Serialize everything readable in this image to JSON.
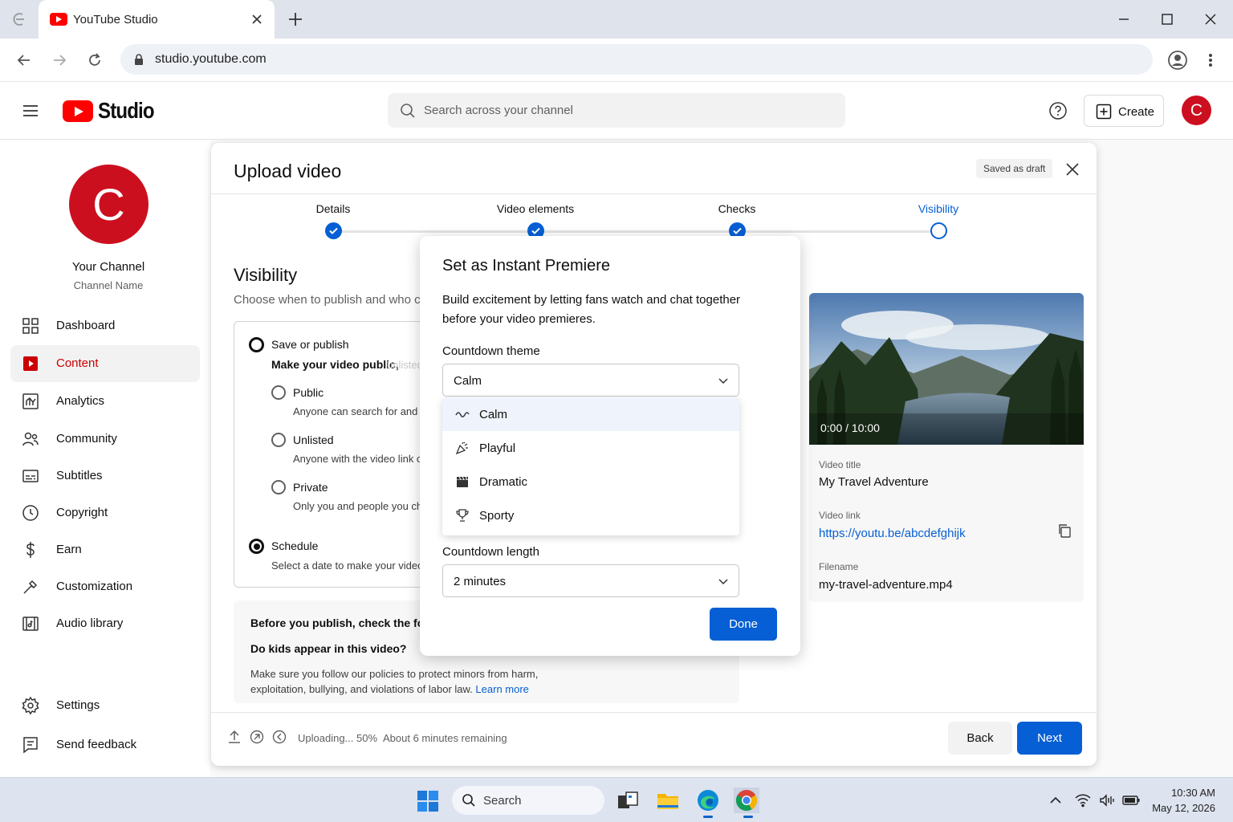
{
  "browser": {
    "tab_title": "YouTube Studio",
    "url": "studio.youtube.com"
  },
  "header": {
    "logo_text": "Studio",
    "search_placeholder": "Search across your channel",
    "create_label": "Create",
    "avatar_letter": "C"
  },
  "sidebar": {
    "avatar_letter": "C",
    "channel_title": "Your Channel",
    "channel_handle": "Channel Name",
    "items": [
      {
        "label": "Dashboard",
        "icon": "dashboard-icon"
      },
      {
        "label": "Content",
        "icon": "content-icon",
        "active": true
      },
      {
        "label": "Analytics",
        "icon": "analytics-icon"
      },
      {
        "label": "Community",
        "icon": "community-icon"
      },
      {
        "label": "Subtitles",
        "icon": "subtitles-icon"
      },
      {
        "label": "Copyright",
        "icon": "copyright-icon"
      },
      {
        "label": "Earn",
        "icon": "earn-icon"
      },
      {
        "label": "Customization",
        "icon": "customization-icon"
      },
      {
        "label": "Audio library",
        "icon": "audio-library-icon"
      }
    ],
    "bottom_items": [
      {
        "label": "Settings",
        "icon": "gear-icon"
      },
      {
        "label": "Send feedback",
        "icon": "feedback-icon"
      }
    ]
  },
  "upload": {
    "title": "Upload video",
    "draft_badge": "Saved as draft",
    "steps": [
      {
        "label": "Details",
        "state": "done"
      },
      {
        "label": "Video elements",
        "state": "done"
      },
      {
        "label": "Checks",
        "state": "done"
      },
      {
        "label": "Visibility",
        "state": "current"
      }
    ],
    "visibility": {
      "title": "Visibility",
      "subtitle": "Choose when to publish and who can see your video",
      "save_publish": "Save or publish",
      "save_publish_sub": "Make your video public,",
      "save_publish_sub_faded": "unlisted, or private",
      "options": [
        {
          "label": "Public",
          "desc": "Anyone can search for and"
        },
        {
          "label": "Unlisted",
          "desc": "Anyone with the video link c"
        },
        {
          "label": "Private",
          "desc": "Only you and people you ch"
        }
      ],
      "schedule": "Schedule",
      "schedule_desc": "Select a date to make your video"
    },
    "kids": {
      "heading": "Before you publish, check the following:",
      "question": "Do kids appear in this video?",
      "body": "Make sure you follow our policies to protect minors from harm, exploitation, bullying, and violations of labor law.",
      "learn_more": "Learn more"
    },
    "preview": {
      "time": "0:00 / 10:00",
      "title_label": "Video title",
      "title_value": "My Travel Adventure",
      "link_label": "Video link",
      "link_value": "https://youtu.be/abcdefghijk",
      "filename_label": "Filename",
      "filename_value": "my-travel-adventure.mp4"
    },
    "footer": {
      "status": "Uploading... 50%",
      "remaining": "About 6 minutes remaining",
      "back": "Back",
      "next": "Next"
    }
  },
  "premiere": {
    "title": "Set as Instant Premiere",
    "description": "Build excitement by letting fans watch and chat together before your video premieres.",
    "theme_label": "Countdown theme",
    "theme_value": "Calm",
    "theme_options": [
      {
        "label": "Calm",
        "icon": "wave-icon",
        "selected": true
      },
      {
        "label": "Playful",
        "icon": "party-popper-icon"
      },
      {
        "label": "Dramatic",
        "icon": "clapperboard-icon"
      },
      {
        "label": "Sporty",
        "icon": "trophy-icon"
      }
    ],
    "length_label": "Countdown length",
    "length_value": "2 minutes",
    "done": "Done"
  },
  "taskbar": {
    "search_label": "Search",
    "time": "10:30 AM",
    "date": "May 12, 2026"
  },
  "colors": {
    "brand_red": "#ff0000",
    "avatar_red": "#cc0f1f",
    "accent_blue": "#065fd4"
  }
}
